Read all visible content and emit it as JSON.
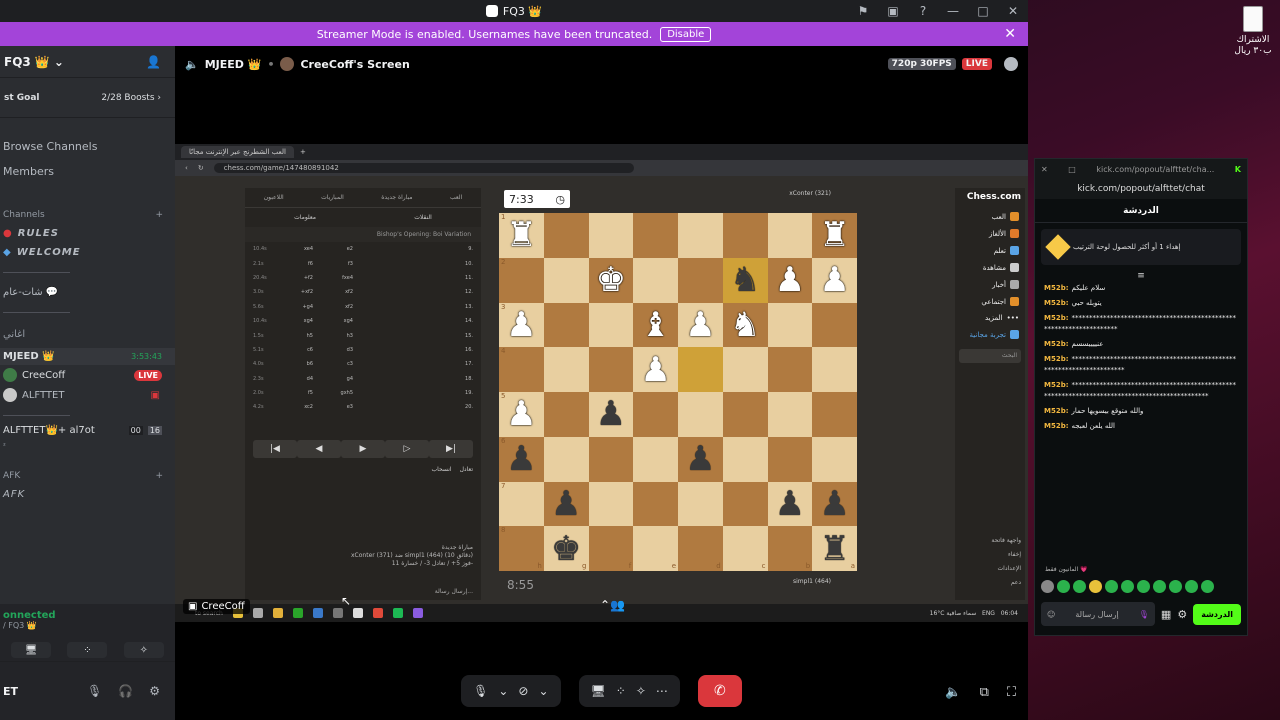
{
  "window": {
    "title": "FQ3 👑"
  },
  "streamer_banner": {
    "text": "Streamer Mode is enabled. Usernames have been truncated.",
    "button": "Disable"
  },
  "sidebar": {
    "server_name": "FQ3 👑",
    "boost_goal": "st Goal",
    "boost_count": "2/28 Boosts",
    "nav": [
      "Browse Channels",
      "Members"
    ],
    "channels_header": "Channels",
    "text_channels": [
      "RULES",
      "WELCOME"
    ],
    "channel_other": "شات-عام 💬",
    "channel_other2": "اغاني",
    "voice_users": [
      {
        "name": "MJEED 👑",
        "time": "3:53:43"
      },
      {
        "name": "CreeCoff",
        "badge": "LIVE"
      },
      {
        "name": "ALFTTET"
      }
    ],
    "voice2_name": "ALFTTET👑+ al7ot",
    "voice2_counts": [
      "00",
      "16"
    ],
    "voice2_sub": "²",
    "afk_cat": "AFK",
    "afk_chan": "AFK"
  },
  "connection": {
    "status": "onnected",
    "server": "/ FQ3 👑"
  },
  "userbar": {
    "name": "ET"
  },
  "stage_header": {
    "user": "MJEED 👑",
    "screen": "CreeCoff's Screen",
    "resolution": "720p 30FPS",
    "live": "LIVE"
  },
  "browser": {
    "tab": "العب الشطرنج عبر الإنترنت مجانًا",
    "url": "chess.com/game/147480891042"
  },
  "chess": {
    "top_tabs": [
      "اللاعبون",
      "المباريات",
      "مباراة جديدة",
      "العب"
    ],
    "sub_tabs": [
      "معلومات",
      "النقلات"
    ],
    "opening": "Bishop's Opening: Boi Variation",
    "moves": [
      {
        "n": "9.",
        "w": "e2",
        "b": "xe4",
        "t": "10.4s"
      },
      {
        "n": "10.",
        "w": "f3",
        "b": "f6",
        "t": "2.1s"
      },
      {
        "n": "11.",
        "w": "fxe4",
        "b": "+f2",
        "t": "20.4s"
      },
      {
        "n": "12.",
        "w": "xf2",
        "b": "+xf2",
        "t": "3.0s"
      },
      {
        "n": "13.",
        "w": "xf2",
        "b": "+g4",
        "t": "5.6s"
      },
      {
        "n": "14.",
        "w": "xg4",
        "b": "xg4",
        "t": "10.4s"
      },
      {
        "n": "15.",
        "w": "h3",
        "b": "h5",
        "t": "1.5s"
      },
      {
        "n": "16.",
        "w": "d3",
        "b": "c6",
        "t": "5.1s"
      },
      {
        "n": "17.",
        "w": "c3",
        "b": "b6",
        "t": "4.0s"
      },
      {
        "n": "18.",
        "w": "g4",
        "b": "d4",
        "t": "2.3s"
      },
      {
        "n": "19.",
        "w": "gxh5",
        "b": "f5",
        "t": "2.0s"
      },
      {
        "n": "20.",
        "w": "e3",
        "b": "xc2",
        "t": "4.2s"
      }
    ],
    "options": [
      "تعادل",
      "انسحاب"
    ],
    "game_info": [
      "مباراة جديدة",
      "xConter (371) ضد simpl1 (464) (10 دقائق)",
      "فوز 5+ / تعادل 3- / خسارة 11-"
    ],
    "chat_placeholder": "إرسال رسالة...",
    "clock_top": "7:33",
    "clock_bottom": "8:55",
    "player_top": "xConter (321)",
    "player_bottom": "simpl1 (464)",
    "files": [
      "h",
      "g",
      "f",
      "e",
      "d",
      "c",
      "b",
      "a"
    ],
    "ranks": [
      "1",
      "2",
      "3",
      "4",
      "5",
      "6",
      "7",
      "8"
    ],
    "board": [
      [
        "wR",
        "",
        "",
        "",
        "",
        "",
        "",
        "wR"
      ],
      [
        "",
        "",
        "wK",
        "",
        "",
        "bN",
        "wP",
        "wP"
      ],
      [
        "wP",
        "",
        "",
        "wB",
        "wP",
        "wN",
        "",
        ""
      ],
      [
        "",
        "",
        "",
        "wP",
        "",
        "",
        "",
        ""
      ],
      [
        "wP",
        "",
        "bP",
        "",
        "",
        "",
        "",
        ""
      ],
      [
        "bP",
        "",
        "",
        "",
        "bP",
        "",
        "",
        ""
      ],
      [
        "",
        "bP",
        "",
        "",
        "",
        "",
        "bP",
        "bP"
      ],
      [
        "",
        "bK",
        "",
        "",
        "",
        "",
        "",
        "bR"
      ]
    ],
    "highlight": [
      [
        1,
        5
      ],
      [
        3,
        4
      ]
    ],
    "nav": [
      "العب",
      "الألغاز",
      "تعلم",
      "مشاهدة",
      "أخبار",
      "اجتماعي",
      "المزيد",
      "تجربة مجانية"
    ],
    "search": "البحث",
    "nav_bottom": [
      "واجهة فاتحة",
      "إخفاء",
      "الإعدادات",
      "دعم"
    ],
    "logo": "Chess.com"
  },
  "taskbar": {
    "search": "to search",
    "weather": "16°C",
    "weather_text": "سماء صافية",
    "lang": "ENG",
    "time": "06:04"
  },
  "stream_tag": "CreeCoff",
  "kick": {
    "window_url": "kick.com/popout/alfttet/cha...",
    "url": "kick.com/popout/alfttet/chat",
    "header": "الدردشة",
    "pinned": "إهداء 1 أو أكثر للحصول لوحة الترتيب",
    "messages": [
      {
        "user": "M52b:",
        "text": "سلام عليكم"
      },
      {
        "user": "M52b:",
        "text": "يتوبله حبي"
      },
      {
        "user": "M52b:",
        "text": "********************************************************************"
      },
      {
        "user": "M52b:",
        "text": "عنييييسسم"
      },
      {
        "user": "M52b:",
        "text": "**********************************************************************"
      },
      {
        "user": "M52b:",
        "text": "**********************************************************************************************"
      },
      {
        "user": "M52b:",
        "text": "والله متوقع بيسويها حمار"
      },
      {
        "user": "M52b:",
        "text": "الله يلعن لعبجه"
      }
    ],
    "emote_label": "المانيون فقط 💗",
    "input_placeholder": "إرسال رسالة",
    "send": "الدردشة"
  },
  "desktop_file": "الاشتراك ب٣٠ ريال",
  "colors": {
    "accent": "#a344d9",
    "live": "#da373c",
    "kick": "#53fc18"
  }
}
